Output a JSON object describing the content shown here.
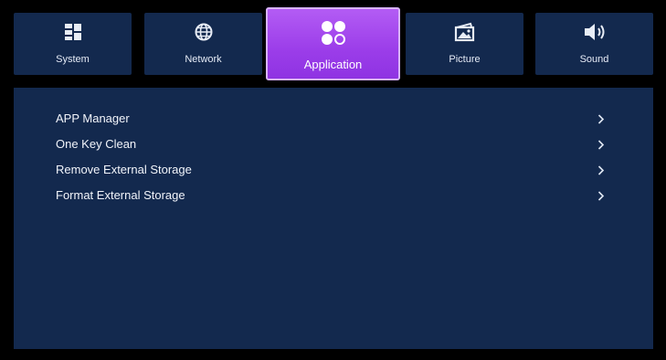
{
  "tabs": [
    {
      "label": "System",
      "icon": "system-grid-icon"
    },
    {
      "label": "Network",
      "icon": "globe-icon"
    },
    {
      "label": "Application",
      "icon": "apps-icon",
      "active": true
    },
    {
      "label": "Picture",
      "icon": "picture-icon"
    },
    {
      "label": "Sound",
      "icon": "speaker-icon"
    }
  ],
  "menu": {
    "items": [
      {
        "label": "APP Manager"
      },
      {
        "label": "One Key Clean"
      },
      {
        "label": "Remove External Storage"
      },
      {
        "label": "Format External Storage"
      }
    ]
  },
  "colors": {
    "background": "#000000",
    "panel": "#13294e",
    "active_tab": "#9b3de9",
    "active_border": "#d8b3ff",
    "text": "#f1f4fa"
  }
}
